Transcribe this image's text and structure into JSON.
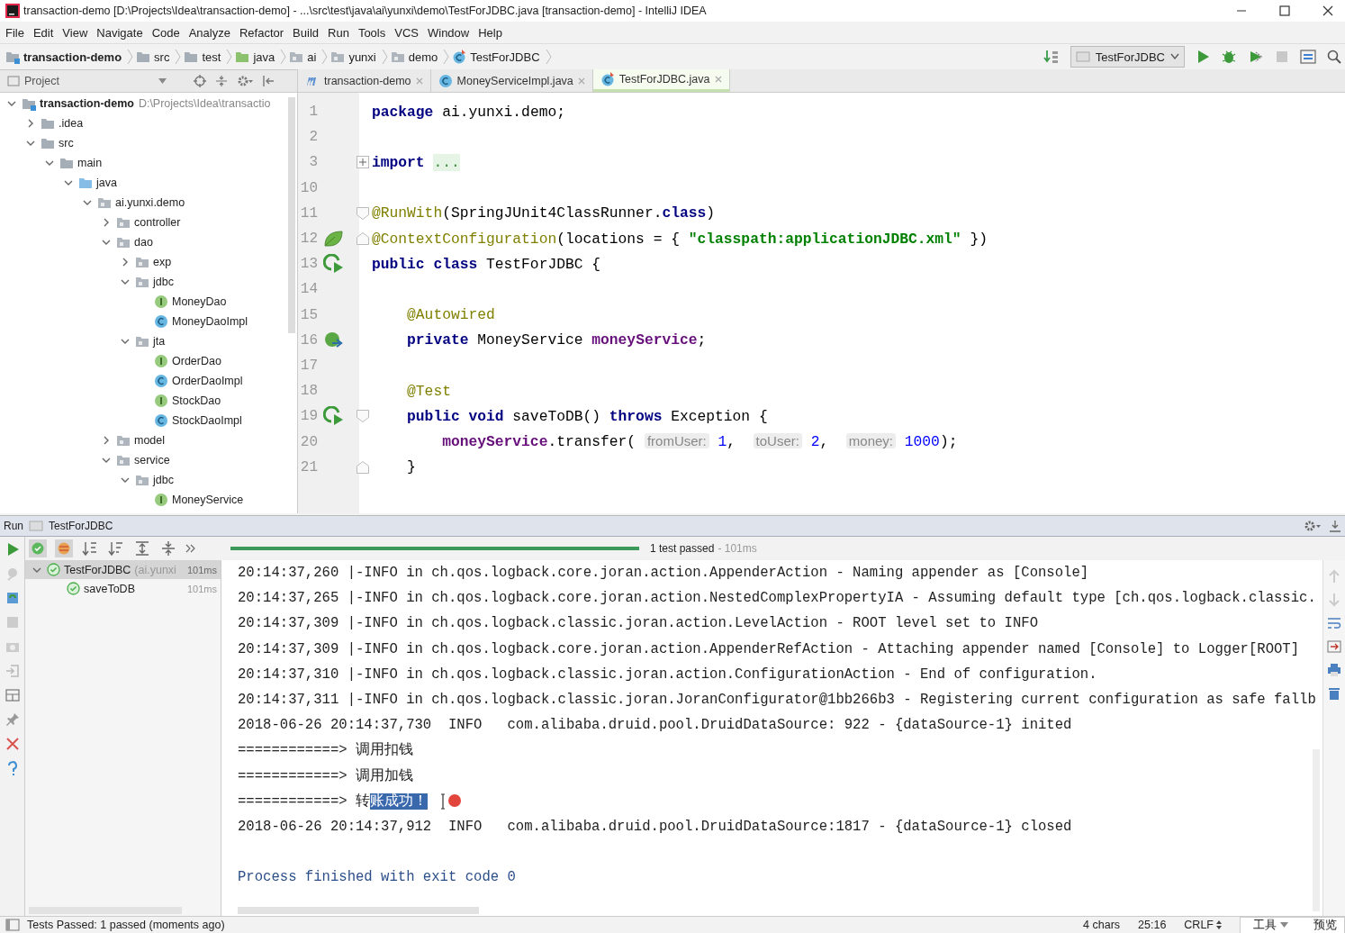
{
  "window": {
    "title": "transaction-demo [D:\\Projects\\Idea\\transaction-demo] - ...\\src\\test\\java\\ai\\yunxi\\demo\\TestForJDBC.java [transaction-demo] - IntelliJ IDEA"
  },
  "menu": [
    "File",
    "Edit",
    "View",
    "Navigate",
    "Code",
    "Analyze",
    "Refactor",
    "Build",
    "Run",
    "Tools",
    "VCS",
    "Window",
    "Help"
  ],
  "breadcrumbs": [
    {
      "label": "transaction-demo",
      "kind": "project"
    },
    {
      "label": "src",
      "kind": "folder"
    },
    {
      "label": "test",
      "kind": "folder"
    },
    {
      "label": "java",
      "kind": "test-root"
    },
    {
      "label": "ai",
      "kind": "package"
    },
    {
      "label": "yunxi",
      "kind": "package"
    },
    {
      "label": "demo",
      "kind": "package"
    },
    {
      "label": "TestForJDBC",
      "kind": "test-class"
    }
  ],
  "run_config": {
    "label": "TestForJDBC"
  },
  "project_panel": {
    "title": "Project",
    "tree": [
      {
        "label": "transaction-demo",
        "path": "D:\\Projects\\Idea\\transactio",
        "kind": "project",
        "expanded": true,
        "children": [
          {
            "label": ".idea",
            "kind": "folder",
            "expanded": false
          },
          {
            "label": "src",
            "kind": "folder",
            "expanded": true,
            "children": [
              {
                "label": "main",
                "kind": "folder",
                "expanded": true,
                "children": [
                  {
                    "label": "java",
                    "kind": "source",
                    "expanded": true,
                    "children": [
                      {
                        "label": "ai.yunxi.demo",
                        "kind": "package",
                        "expanded": true,
                        "children": [
                          {
                            "label": "controller",
                            "kind": "package",
                            "expanded": false
                          },
                          {
                            "label": "dao",
                            "kind": "package",
                            "expanded": true,
                            "children": [
                              {
                                "label": "exp",
                                "kind": "package",
                                "expanded": false
                              },
                              {
                                "label": "jdbc",
                                "kind": "package",
                                "expanded": true,
                                "children": [
                                  {
                                    "label": "MoneyDao",
                                    "kind": "interface"
                                  },
                                  {
                                    "label": "MoneyDaoImpl",
                                    "kind": "class"
                                  }
                                ]
                              },
                              {
                                "label": "jta",
                                "kind": "package",
                                "expanded": true,
                                "children": [
                                  {
                                    "label": "OrderDao",
                                    "kind": "interface"
                                  },
                                  {
                                    "label": "OrderDaoImpl",
                                    "kind": "class"
                                  },
                                  {
                                    "label": "StockDao",
                                    "kind": "interface"
                                  },
                                  {
                                    "label": "StockDaoImpl",
                                    "kind": "class"
                                  }
                                ]
                              }
                            ]
                          },
                          {
                            "label": "model",
                            "kind": "package",
                            "expanded": false
                          },
                          {
                            "label": "service",
                            "kind": "package",
                            "expanded": true,
                            "children": [
                              {
                                "label": "jdbc",
                                "kind": "package",
                                "expanded": true,
                                "children": [
                                  {
                                    "label": "MoneyService",
                                    "kind": "interface"
                                  }
                                ]
                              }
                            ]
                          }
                        ]
                      }
                    ]
                  }
                ]
              }
            ]
          }
        ]
      }
    ]
  },
  "editor_tabs": [
    {
      "label": "transaction-demo",
      "kind": "module",
      "selected": false
    },
    {
      "label": "MoneyServiceImpl.java",
      "kind": "class",
      "selected": false
    },
    {
      "label": "TestForJDBC.java",
      "kind": "test-class",
      "selected": true
    }
  ],
  "editor": {
    "lines": [
      {
        "number": "1",
        "tokens": [
          {
            "kind": "kw",
            "text": "package"
          },
          {
            "kind": "plain",
            "text": " ai.yunxi.demo;"
          }
        ]
      },
      {
        "number": "2"
      },
      {
        "number": "3",
        "fold": {
          "kind": "expand"
        },
        "tokens": [
          {
            "kind": "kw",
            "text": "import "
          },
          {
            "kind": "folded",
            "text": "..."
          }
        ]
      },
      {
        "number": "10"
      },
      {
        "number": "11",
        "fold": {
          "kind": "start"
        },
        "tokens": [
          {
            "kind": "ann",
            "text": "@RunWith"
          },
          {
            "kind": "plain",
            "text": "(SpringJUnit4ClassRunner."
          },
          {
            "kind": "kw",
            "text": "class"
          },
          {
            "kind": "plain",
            "text": ")"
          }
        ]
      },
      {
        "number": "12",
        "gutter_icon": {
          "kind": "leaf"
        },
        "fold": {
          "kind": "end"
        },
        "tokens": [
          {
            "kind": "ann",
            "text": "@ContextConfiguration"
          },
          {
            "kind": "plain",
            "text": "(locations = { "
          },
          {
            "kind": "str",
            "text": "\"classpath:applicationJDBC.xml\""
          },
          {
            "kind": "plain",
            "text": " })"
          }
        ]
      },
      {
        "number": "13",
        "gutter_icon": {
          "kind": "run"
        },
        "tokens": [
          {
            "kind": "kw",
            "text": "public class"
          },
          {
            "kind": "plain",
            "text": " TestForJDBC {"
          }
        ]
      },
      {
        "number": "14"
      },
      {
        "number": "15",
        "tokens": [
          {
            "kind": "ann",
            "text": "    @Autowired"
          }
        ]
      },
      {
        "number": "16",
        "gutter_icon": {
          "kind": "bean"
        },
        "tokens": [
          {
            "kind": "kw",
            "text": "    private"
          },
          {
            "kind": "plain",
            "text": " MoneyService "
          },
          {
            "kind": "field",
            "text": "moneyService"
          },
          {
            "kind": "plain",
            "text": ";"
          }
        ]
      },
      {
        "number": "17"
      },
      {
        "number": "18",
        "tokens": [
          {
            "kind": "ann",
            "text": "    @Test"
          }
        ]
      },
      {
        "number": "19",
        "gutter_icon": {
          "kind": "run"
        },
        "fold": {
          "kind": "start"
        },
        "tokens": [
          {
            "kind": "kw",
            "text": "    public void"
          },
          {
            "kind": "plain",
            "text": " saveToDB() "
          },
          {
            "kind": "kw",
            "text": "throws"
          },
          {
            "kind": "plain",
            "text": " Exception {"
          }
        ]
      },
      {
        "number": "20",
        "tokens": [
          {
            "kind": "field",
            "text": "        moneyService"
          },
          {
            "kind": "plain",
            "text": ".transfer( "
          },
          {
            "kind": "hint",
            "text": "fromUser:"
          },
          {
            "kind": "num",
            "text": " 1"
          },
          {
            "kind": "plain",
            "text": ",  "
          },
          {
            "kind": "hint",
            "text": "toUser:"
          },
          {
            "kind": "num",
            "text": " 2"
          },
          {
            "kind": "plain",
            "text": ",  "
          },
          {
            "kind": "hint",
            "text": "money:"
          },
          {
            "kind": "num",
            "text": " 1000"
          },
          {
            "kind": "plain",
            "text": ");"
          }
        ]
      },
      {
        "number": "21",
        "fold": {
          "kind": "end"
        },
        "tokens": [
          {
            "kind": "plain",
            "text": "    }"
          }
        ]
      }
    ]
  },
  "run_panel": {
    "title": "Run",
    "config": "TestForJDBC",
    "progress": {
      "level": 1
    },
    "status": "1 test passed",
    "duration": "- 101ms",
    "tests": [
      {
        "name": "TestForJDBC",
        "detail": "(ai.yunxi",
        "time": "101ms",
        "passed": true,
        "selected": true,
        "expanded": true,
        "children": [
          {
            "name": "saveToDB",
            "time": "101ms",
            "passed": true,
            "selected": false
          }
        ]
      }
    ],
    "console": [
      {
        "kind": "log",
        "text": "20:14:37,260 |-INFO in ch.qos.logback.core.joran.action.AppenderAction - Naming appender as [Console]"
      },
      {
        "kind": "log",
        "text": "20:14:37,265 |-INFO in ch.qos.logback.core.joran.action.NestedComplexPropertyIA - Assuming default type [ch.qos.logback.classic."
      },
      {
        "kind": "log",
        "text": "20:14:37,309 |-INFO in ch.qos.logback.classic.joran.action.LevelAction - ROOT level set to INFO"
      },
      {
        "kind": "log",
        "text": "20:14:37,309 |-INFO in ch.qos.logback.core.joran.action.AppenderRefAction - Attaching appender named [Console] to Logger[ROOT]"
      },
      {
        "kind": "log",
        "text": "20:14:37,310 |-INFO in ch.qos.logback.classic.joran.action.ConfigurationAction - End of configuration."
      },
      {
        "kind": "log",
        "text": "20:14:37,311 |-INFO in ch.qos.logback.classic.joran.JoranConfigurator@1bb266b3 - Registering current configuration as safe fallb"
      },
      {
        "kind": "log",
        "text": "2018-06-26 20:14:37,730  INFO   com.alibaba.druid.pool.DruidDataSource: 922 - {dataSource-1} inited"
      },
      {
        "kind": "log",
        "text": "============> 调用扣钱"
      },
      {
        "kind": "log",
        "text": "============> 调用加钱"
      },
      {
        "kind": "log",
        "parts": [
          {
            "text": "============> 转",
            "selected": false
          },
          {
            "text": "账成功！",
            "selected": true
          }
        ]
      },
      {
        "kind": "log",
        "text": "2018-06-26 20:14:37,912  INFO   com.alibaba.druid.pool.DruidDataSource:1817 - {dataSource-1} closed"
      },
      {
        "kind": "exit",
        "text": "Process finished with exit code 0"
      }
    ]
  },
  "status_bar": {
    "message": "Tests Passed: 1 passed (moments ago)",
    "chars": "4 chars",
    "position": "25:16",
    "line_separator": "CRLF",
    "ime": [
      "工具",
      "预览"
    ]
  }
}
